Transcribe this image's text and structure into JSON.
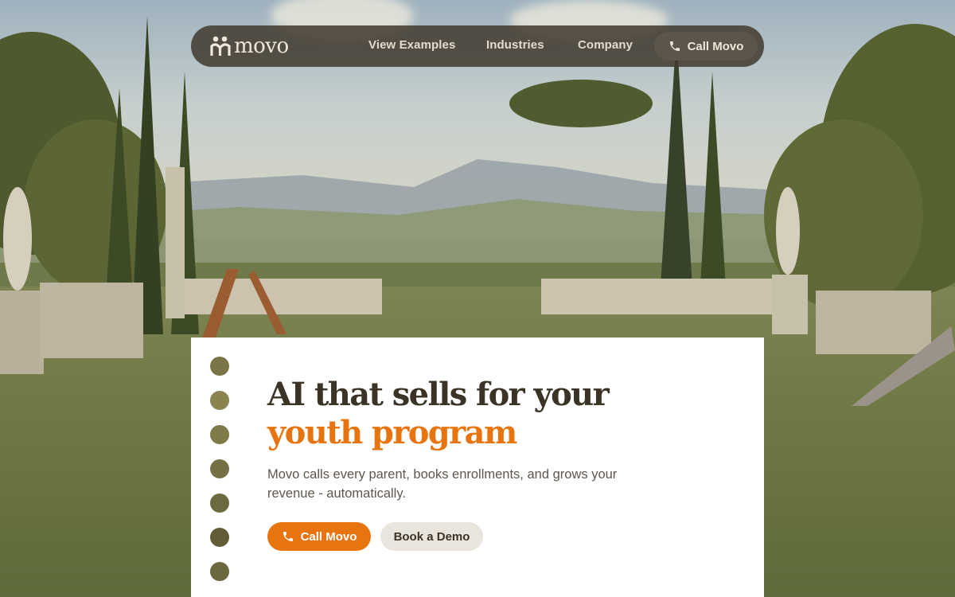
{
  "brand": {
    "name": "movo",
    "accent": "#e8740f",
    "nav_bg": "#423a2e"
  },
  "nav": {
    "links": [
      "View Examples",
      "Industries",
      "Company"
    ],
    "call_label": "Call Movo",
    "call_icon": "phone-icon"
  },
  "hero": {
    "headline_line1": "AI that sells for your",
    "headline_line2": "youth program",
    "subtitle": "Movo calls every parent, books enrollments, and grows your revenue - automatically.",
    "primary_label": "Call Movo",
    "primary_icon": "phone-icon",
    "secondary_label": "Book a Demo",
    "dot_colors": [
      "#7a7446",
      "#8a8350",
      "#7f7a48",
      "#767145",
      "#6e6a3f",
      "#635d37",
      "#6c683e"
    ]
  }
}
